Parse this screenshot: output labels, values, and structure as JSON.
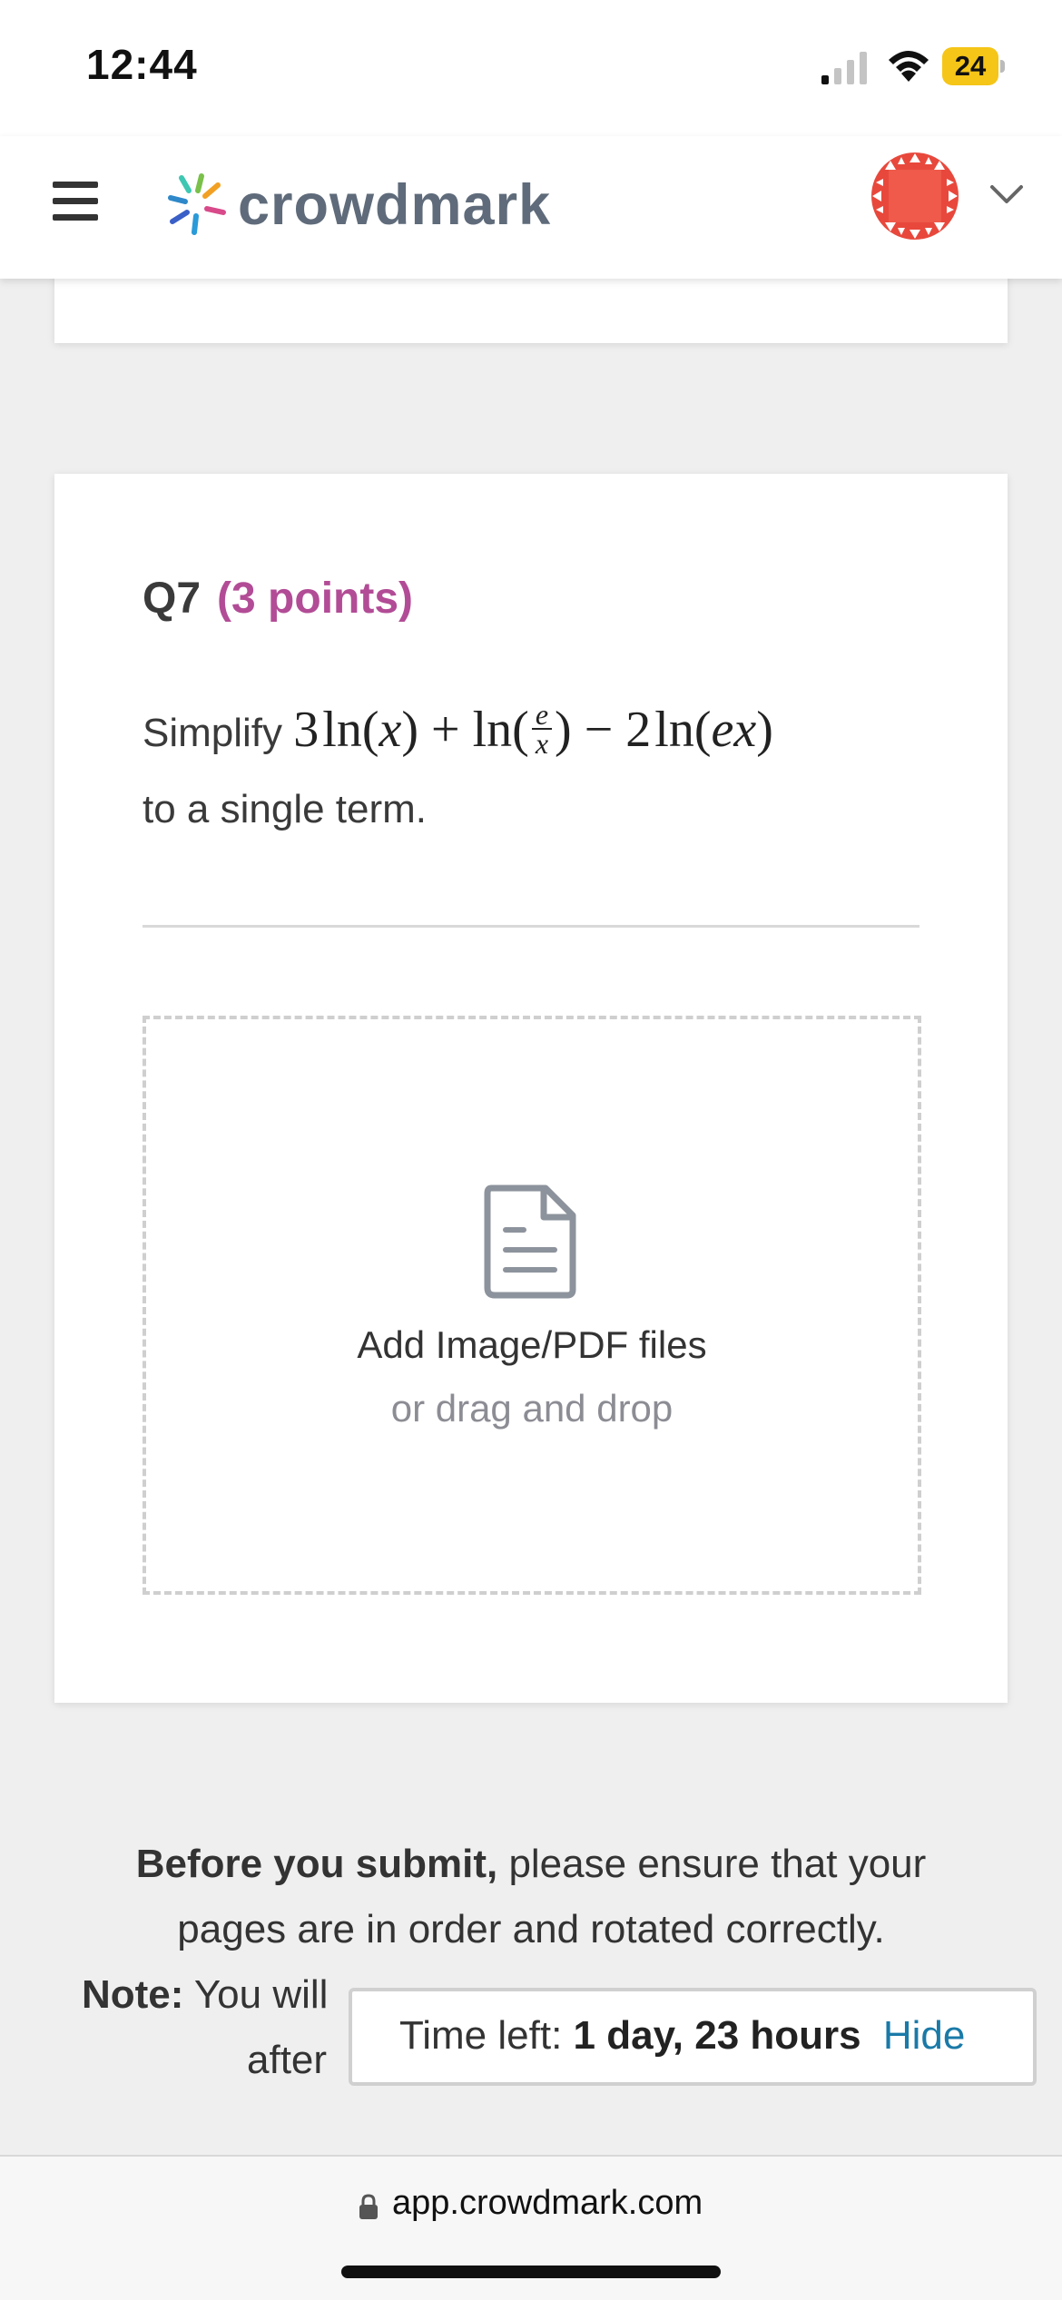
{
  "status_bar": {
    "time": "12:44",
    "battery_level": "24",
    "icons": [
      "cellular-signal-icon",
      "wifi-icon",
      "battery-icon"
    ],
    "battery_color": "#f5c518"
  },
  "header": {
    "logo_text": "crowdmark",
    "icons": [
      "hamburger-menu-icon",
      "crowdmark-logo-icon",
      "avatar-icon",
      "chevron-down-icon"
    ],
    "avatar_color": "#e8483c"
  },
  "question": {
    "number": "Q7",
    "points": "(3 points)",
    "prompt_prefix": "Simplify",
    "math": {
      "term1_coeff": "3",
      "ln": "ln",
      "x": "x",
      "plus": "+",
      "frac_num": "e",
      "frac_den": "x",
      "minus": "−",
      "term3_coeff": "2",
      "ex": "ex"
    },
    "prompt_suffix": "to a single term.",
    "points_color": "#b24c96"
  },
  "upload": {
    "primary_label": "Add Image/PDF files",
    "secondary_label": "or drag and drop",
    "icon": "document-icon"
  },
  "submit_note": {
    "bold_lead": "Before you submit,",
    "line1_rest": "please ensure that your",
    "line2": "pages are in order and rotated correctly.",
    "note_label": "Note:",
    "line3_rest": "You will",
    "line4": "after"
  },
  "timer": {
    "label": "Time left:",
    "value": "1 day, 23 hours",
    "hide_label": "Hide",
    "link_color": "#1a7aa8"
  },
  "browser": {
    "url": "app.crowdmark.com",
    "icon": "lock-icon"
  }
}
